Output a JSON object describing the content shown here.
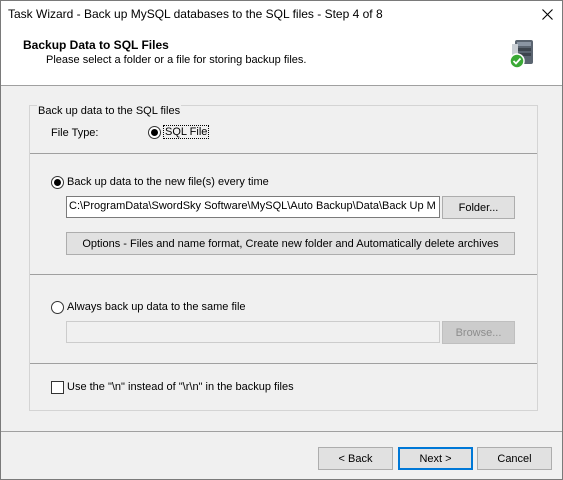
{
  "window": {
    "title": "Task Wizard - Back up MySQL databases to the SQL files - Step 4 of 8"
  },
  "header": {
    "title": "Backup Data to SQL Files",
    "subtitle": "Please select a folder or a file for storing backup files.",
    "icon": "database-check-icon"
  },
  "group": {
    "label": "Back up data to the SQL files",
    "file_type_label": "File Type:",
    "file_type_option": "SQL File"
  },
  "new_file": {
    "radio_label": "Back up data to the new file(s) every time",
    "path": "C:\\ProgramData\\SwordSky Software\\MySQL\\Auto Backup\\Data\\Back Up M",
    "folder_button": "Folder...",
    "options_button": "Options - Files and name format, Create new folder and Automatically delete archives"
  },
  "same_file": {
    "radio_label": "Always back up data to the same file",
    "path": "",
    "browse_button": "Browse..."
  },
  "newline_option": {
    "label": "Use the \"\\n\" instead of \"\\r\\n\" in the backup files"
  },
  "footer": {
    "back": "< Back",
    "next": "Next >",
    "cancel": "Cancel"
  },
  "colors": {
    "dialog_bg": "#f0f0f0",
    "default_button_border": "#0078d7",
    "icon_green": "#3aa935"
  }
}
